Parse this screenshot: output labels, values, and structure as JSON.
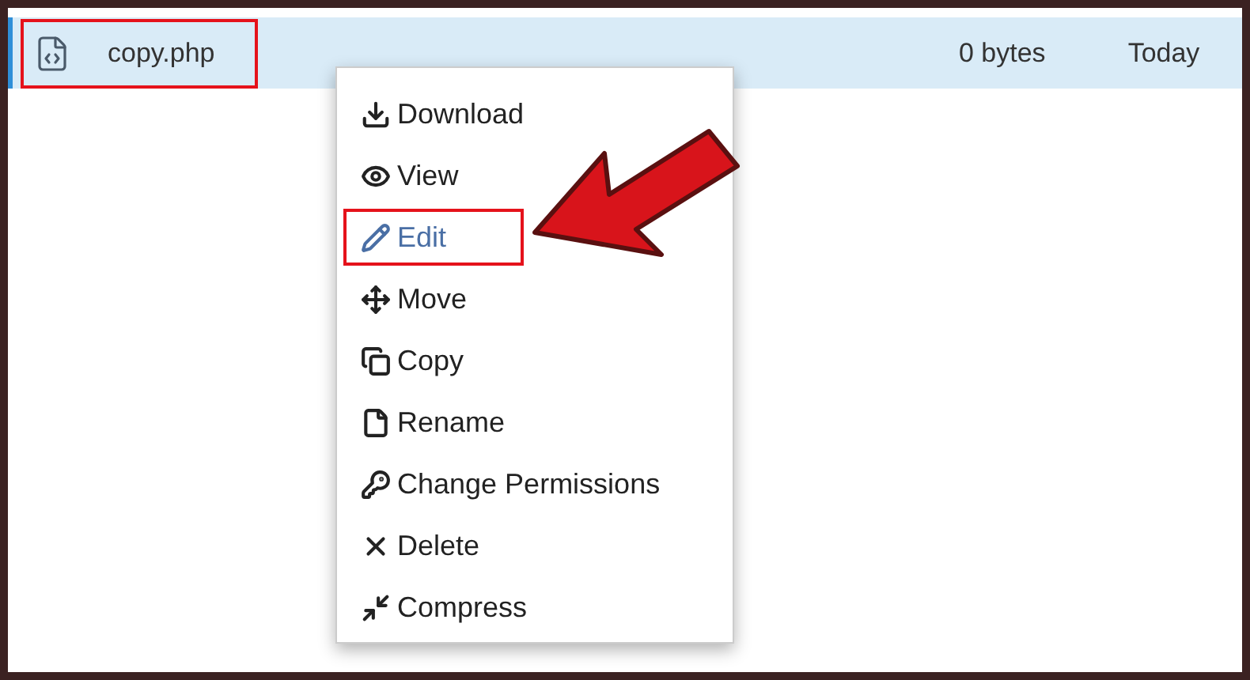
{
  "file_row": {
    "name": "copy.php",
    "size": "0 bytes",
    "modified": "Today",
    "selected": true
  },
  "context_menu": {
    "items": [
      {
        "label": "Download",
        "selected": false
      },
      {
        "label": "View",
        "selected": false
      },
      {
        "label": "Edit",
        "selected": true
      },
      {
        "label": "Move",
        "selected": false
      },
      {
        "label": "Copy",
        "selected": false
      },
      {
        "label": "Rename",
        "selected": false
      },
      {
        "label": "Change Permissions",
        "selected": false
      },
      {
        "label": "Delete",
        "selected": false
      },
      {
        "label": "Compress",
        "selected": false
      }
    ]
  }
}
